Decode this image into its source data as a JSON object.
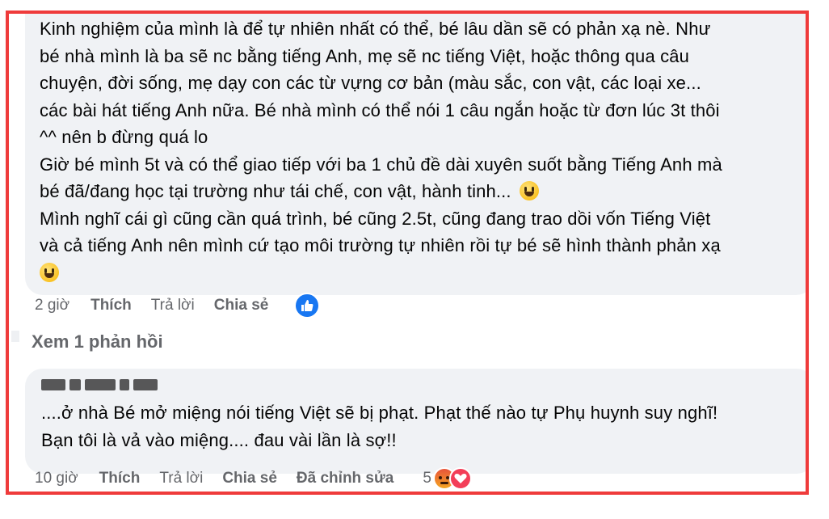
{
  "comment1": {
    "lines": [
      "Kinh nghiệm của mình là để tự nhiên nhất có thể, bé lâu dần sẽ có phản xạ nè. Như",
      "bé nhà mình là ba sẽ nc bằng tiếng Anh, mẹ sẽ nc tiếng Việt, hoặc thông qua câu",
      "chuyện, đời sống, mẹ dạy con các từ vựng cơ bản (màu sắc, con vật, các loại xe...",
      "các bài hát tiếng Anh nữa. Bé nhà mình có thể nói 1 câu ngắn hoặc từ đơn lúc 3t thôi",
      "^^ nên b đừng quá lo",
      "Giờ bé mình 5t và có thể giao tiếp với ba 1 chủ đề dài xuyên suốt bằng Tiếng Anh mà",
      "bé đã/đang học tại trường như tái chế, con vật, hành tinh...",
      "Mình nghĩ cái gì cũng cần quá trình, bé cũng 2.5t, cũng đang trao dồi vốn Tiếng Việt",
      "và cả tiếng Anh nên mình cứ tạo môi trường tự nhiên rồi tự bé sẽ hình thành phản xạ"
    ],
    "meta": {
      "time": "2 giờ",
      "like": "Thích",
      "reply": "Trả lời",
      "share": "Chia sẻ"
    },
    "reaction_icon": "like-thumb-icon"
  },
  "see_replies": "Xem 1 phản hồi",
  "comment2": {
    "lines": [
      "....ở nhà Bé mở miệng nói tiếng Việt sẽ bị phạt. Phạt thế nào tự Phụ huynh suy nghĩ!",
      "Bạn tôi là vả vào miệng.... đau vài lần là sợ!!"
    ],
    "meta": {
      "time": "10 giờ",
      "like": "Thích",
      "reply": "Trả lời",
      "share": "Chia sẻ",
      "edited": "Đã chỉnh sửa"
    },
    "reaction_count": "5",
    "reaction_icons": [
      "angry-face-icon",
      "heart-icon"
    ]
  },
  "colors": {
    "frame_border": "#ef3b3b",
    "bubble_bg": "#f0f2f5",
    "text": "#050505",
    "meta_text": "#65676b",
    "like_blue": "#1877f2"
  }
}
